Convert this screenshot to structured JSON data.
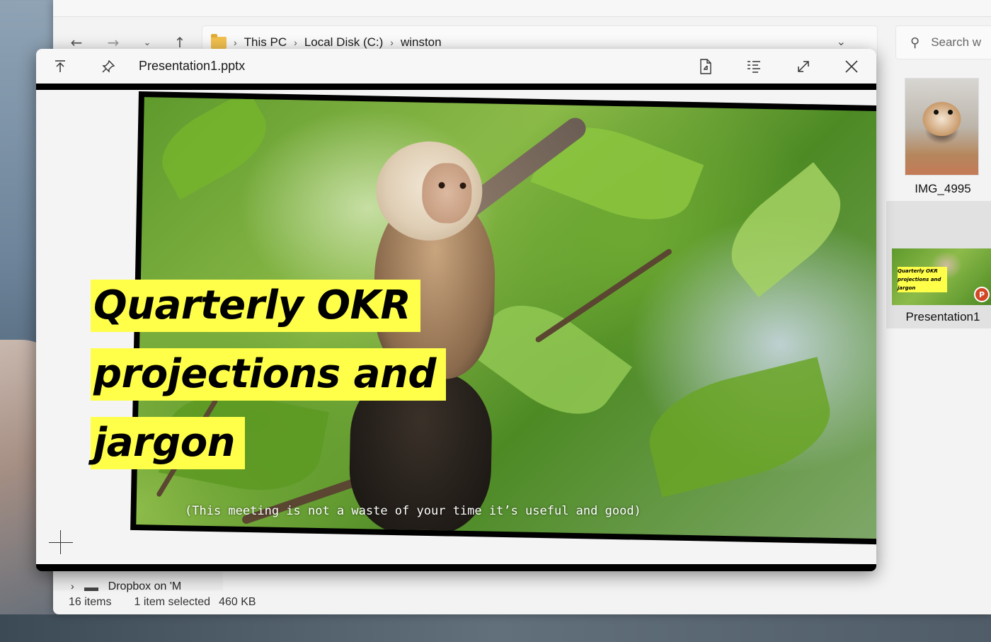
{
  "explorer": {
    "breadcrumb": [
      "This PC",
      "Local Disk (C:)",
      "winston"
    ],
    "search_placeholder": "Search w",
    "files": [
      {
        "name": "IMG_4995",
        "thumb": "dog-photo"
      },
      {
        "name": "Presentation1",
        "thumb": "pptx-thumbnail",
        "thumb_text": "Quarterly OKR projections and jargon"
      }
    ],
    "navpane_item": "Dropbox on 'M",
    "status": {
      "count": "16 items",
      "selection": "1 item selected",
      "size": "460 KB"
    }
  },
  "peek": {
    "title": "Presentation1.pptx",
    "toolbar_icons": [
      "pin-to-top-icon",
      "pin-icon",
      "open-file-icon",
      "details-icon",
      "expand-icon",
      "close-icon"
    ],
    "slide": {
      "title_lines": [
        "Quarterly OKR",
        "projections and",
        "jargon"
      ],
      "subtitle": "(This meeting is not a waste of your time it’s useful and good)"
    }
  },
  "colors": {
    "highlight": "#ffff4a",
    "window_bg": "#f3f3f3"
  }
}
